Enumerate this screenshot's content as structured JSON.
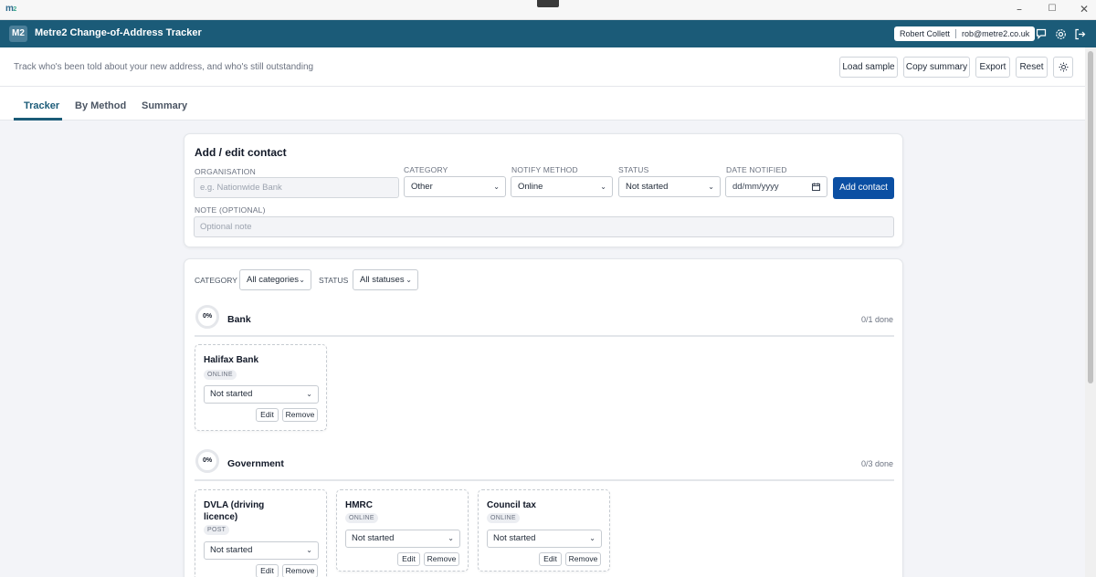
{
  "window": {
    "logo_main": "m",
    "logo_sub": "2",
    "minimize_glyph": "–",
    "maximize_glyph": "☐",
    "close_glyph": "✕"
  },
  "header": {
    "badge": "M2",
    "title": "Metre2 Change-of-Address Tracker",
    "user_name": "Robert Collett",
    "user_email": "rob@metre2.co.uk",
    "icons": [
      "chat-icon",
      "settings-icon",
      "logout-icon"
    ]
  },
  "toolbar": {
    "tagline": "Track who's been told about your new address, and who's still outstanding",
    "load_sample": "Load sample",
    "copy_summary": "Copy summary",
    "export": "Export",
    "reset": "Reset",
    "theme_icon": "sun-icon"
  },
  "tabs": [
    {
      "label": "Tracker",
      "active": true
    },
    {
      "label": "By Method",
      "active": false
    },
    {
      "label": "Summary",
      "active": false
    }
  ],
  "form": {
    "title": "Add / edit contact",
    "organisation_label": "ORGANISATION",
    "organisation_placeholder": "e.g. Nationwide Bank",
    "category_label": "CATEGORY",
    "category_value": "Other",
    "method_label": "NOTIFY METHOD",
    "method_value": "Online",
    "status_label": "STATUS",
    "status_value": "Not started",
    "date_label": "DATE NOTIFIED",
    "date_placeholder": "dd/mm/yyyy",
    "add_button": "Add contact",
    "note_label": "NOTE (OPTIONAL)",
    "note_placeholder": "Optional note"
  },
  "filters": {
    "category_label": "CATEGORY",
    "category_value": "All categories",
    "status_label": "STATUS",
    "status_value": "All statuses"
  },
  "groups": [
    {
      "name": "Bank",
      "percent": "0%",
      "count": "0/1 done",
      "contacts": [
        {
          "name": "Halifax Bank",
          "method": "ONLINE",
          "status": "Not started",
          "edit": "Edit",
          "remove": "Remove"
        }
      ]
    },
    {
      "name": "Government",
      "percent": "0%",
      "count": "0/3 done",
      "contacts": [
        {
          "name": "DVLA (driving licence)",
          "method": "POST",
          "status": "Not started",
          "edit": "Edit",
          "remove": "Remove"
        },
        {
          "name": "HMRC",
          "method": "ONLINE",
          "status": "Not started",
          "edit": "Edit",
          "remove": "Remove"
        },
        {
          "name": "Council tax",
          "method": "ONLINE",
          "status": "Not started",
          "edit": "Edit",
          "remove": "Remove"
        }
      ]
    }
  ]
}
